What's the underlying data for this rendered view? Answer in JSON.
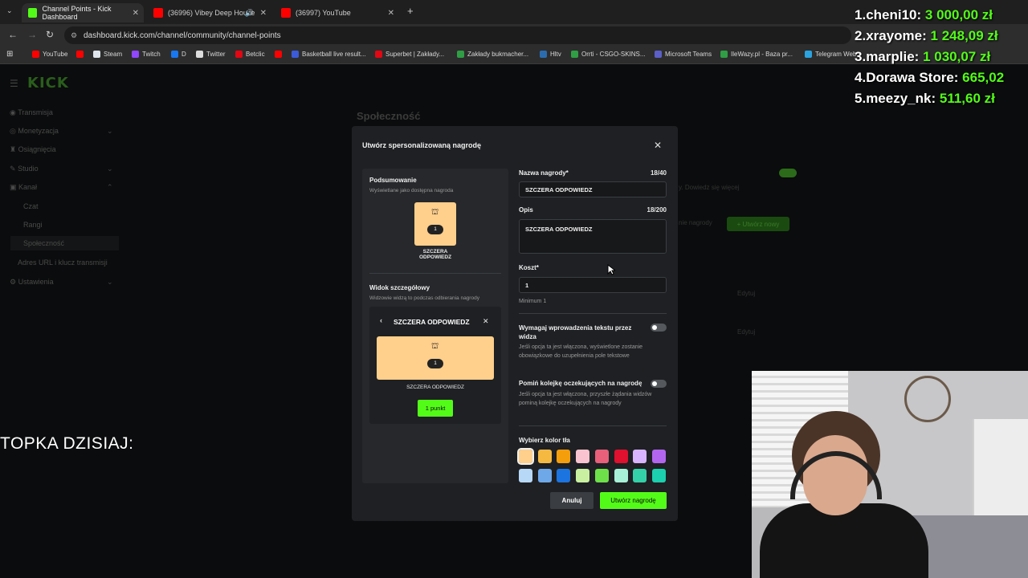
{
  "browser": {
    "tabs": [
      {
        "title": "Channel Points - Kick Dashboard",
        "color": "#53fc18"
      },
      {
        "title": "(36996) Vibey Deep House",
        "color": "#ff0000"
      },
      {
        "title": "(36997) YouTube",
        "color": "#ff0000"
      }
    ],
    "url": "dashboard.kick.com/channel/community/channel-points",
    "bookmarks": [
      {
        "label": "YouTube",
        "color": "#ff0000"
      },
      {
        "label": "",
        "color": "#ff0000"
      },
      {
        "label": "Steam",
        "color": "#1b2838"
      },
      {
        "label": "Twitch",
        "color": "#9146ff"
      },
      {
        "label": "D",
        "color": "#1877f2"
      },
      {
        "label": "Twitter",
        "color": "#111111"
      },
      {
        "label": "Betclic",
        "color": "#e30613"
      },
      {
        "label": "",
        "color": "#ff0000"
      },
      {
        "label": "Basketball live result...",
        "color": "#3b5bdb"
      },
      {
        "label": "Superbet | Zakłady...",
        "color": "#e30613"
      },
      {
        "label": "Zakłady bukmacher...",
        "color": "#2f9e44"
      },
      {
        "label": "Hltv",
        "color": "#2b6cb0"
      },
      {
        "label": "Orrti - CSGO-SKINS...",
        "color": "#2f9e44"
      },
      {
        "label": "Microsoft Teams",
        "color": "#5b5fc7"
      },
      {
        "label": "IleWazy.pl - Baza pr...",
        "color": "#2f9e44"
      },
      {
        "label": "Telegram Web",
        "color": "#2aa3e0"
      }
    ]
  },
  "dashboard": {
    "logo": "KICK",
    "page_title": "Społeczność",
    "sidebar": [
      {
        "label": "Transmisja",
        "icon": "broadcast-icon"
      },
      {
        "label": "Monetyzacja",
        "icon": "money-icon"
      },
      {
        "label": "Osiągnięcia",
        "icon": "trophy-icon"
      },
      {
        "label": "Studio",
        "icon": "studio-icon"
      },
      {
        "label": "Kanał",
        "icon": "channel-icon"
      },
      {
        "label": "Czat"
      },
      {
        "label": "Rangi"
      },
      {
        "label": "Społeczność"
      },
      {
        "label": "Adres URL i klucz transmisji"
      },
      {
        "label": "Ustawienia",
        "icon": "gear-icon"
      }
    ],
    "bg_text_1": "y. Dowiedz się więcej",
    "bg_text_2": "nie nagrody",
    "bg_add_button": "+ Utwórz nowy",
    "bg_edit": "Edytuj"
  },
  "leaderboard": [
    {
      "rank": "1.",
      "name": "cheni10:",
      "amount": "3 000,00 zł"
    },
    {
      "rank": "2.",
      "name": "xrayome:",
      "amount": "1 248,09 zł"
    },
    {
      "rank": "3.",
      "name": "marplie:",
      "amount": "1 030,07 zł"
    },
    {
      "rank": "4.",
      "name": "Dorawa Store:",
      "amount": "665,02"
    },
    {
      "rank": "5.",
      "name": "meezy_nk:",
      "amount": "511,60 zł"
    }
  ],
  "modal": {
    "title": "Utwórz spersonalizowaną nagrodę",
    "summary_title": "Podsumowanie",
    "summary_subtitle": "Wyświetlane jako dostępna nagroda",
    "reward_cost_badge": "1",
    "reward_name_preview": "SZCZERA ODPOWIEDZ",
    "detail_title": "Widok szczegółowy",
    "detail_subtitle": "Widzowie widzą to podczas odbierania nagrody",
    "detail_header": "SZCZERA ODPOWIEDZ",
    "detail_points_button": "1 punkt",
    "name_label": "Nazwa nagrody*",
    "name_count": "18/40",
    "name_value": "SZCZERA ODPOWIEDZ",
    "desc_label": "Opis",
    "desc_count": "18/200",
    "desc_value": "SZCZERA ODPOWIEDZ",
    "cost_label": "Koszt*",
    "cost_value": "1",
    "cost_hint": "Minimum 1",
    "require_text_label": "Wymagaj wprowadzenia tekstu przez widza",
    "require_text_hint": "Jeśli opcja ta jest włączona, wyświetlone zostanie obowiązkowe do uzupełnienia pole tekstowe",
    "skip_queue_label": "Pomiń kolejkę oczekujących na nagrodę",
    "skip_queue_hint": "Jeśli opcja ta jest włączona, przyszłe żądania widzów pominą kolejkę oczekujących na nagrody",
    "color_label": "Wybierz kolor tła",
    "colors": [
      "#ffcf8c",
      "#f5b942",
      "#f59e0b",
      "#f9c4cf",
      "#e8607a",
      "#e0102f",
      "#d8b4fe",
      "#b266f0",
      "#b8d8f8",
      "#6fa8e8",
      "#1c74e0",
      "#c8f0a0",
      "#6ee04a",
      "#a8f0d8",
      "#34d0a8",
      "#1ccfae"
    ],
    "cancel_button": "Anuluj",
    "create_button": "Utwórz nagrodę"
  },
  "overlay_text": "TOPKA DZISIAJ:"
}
